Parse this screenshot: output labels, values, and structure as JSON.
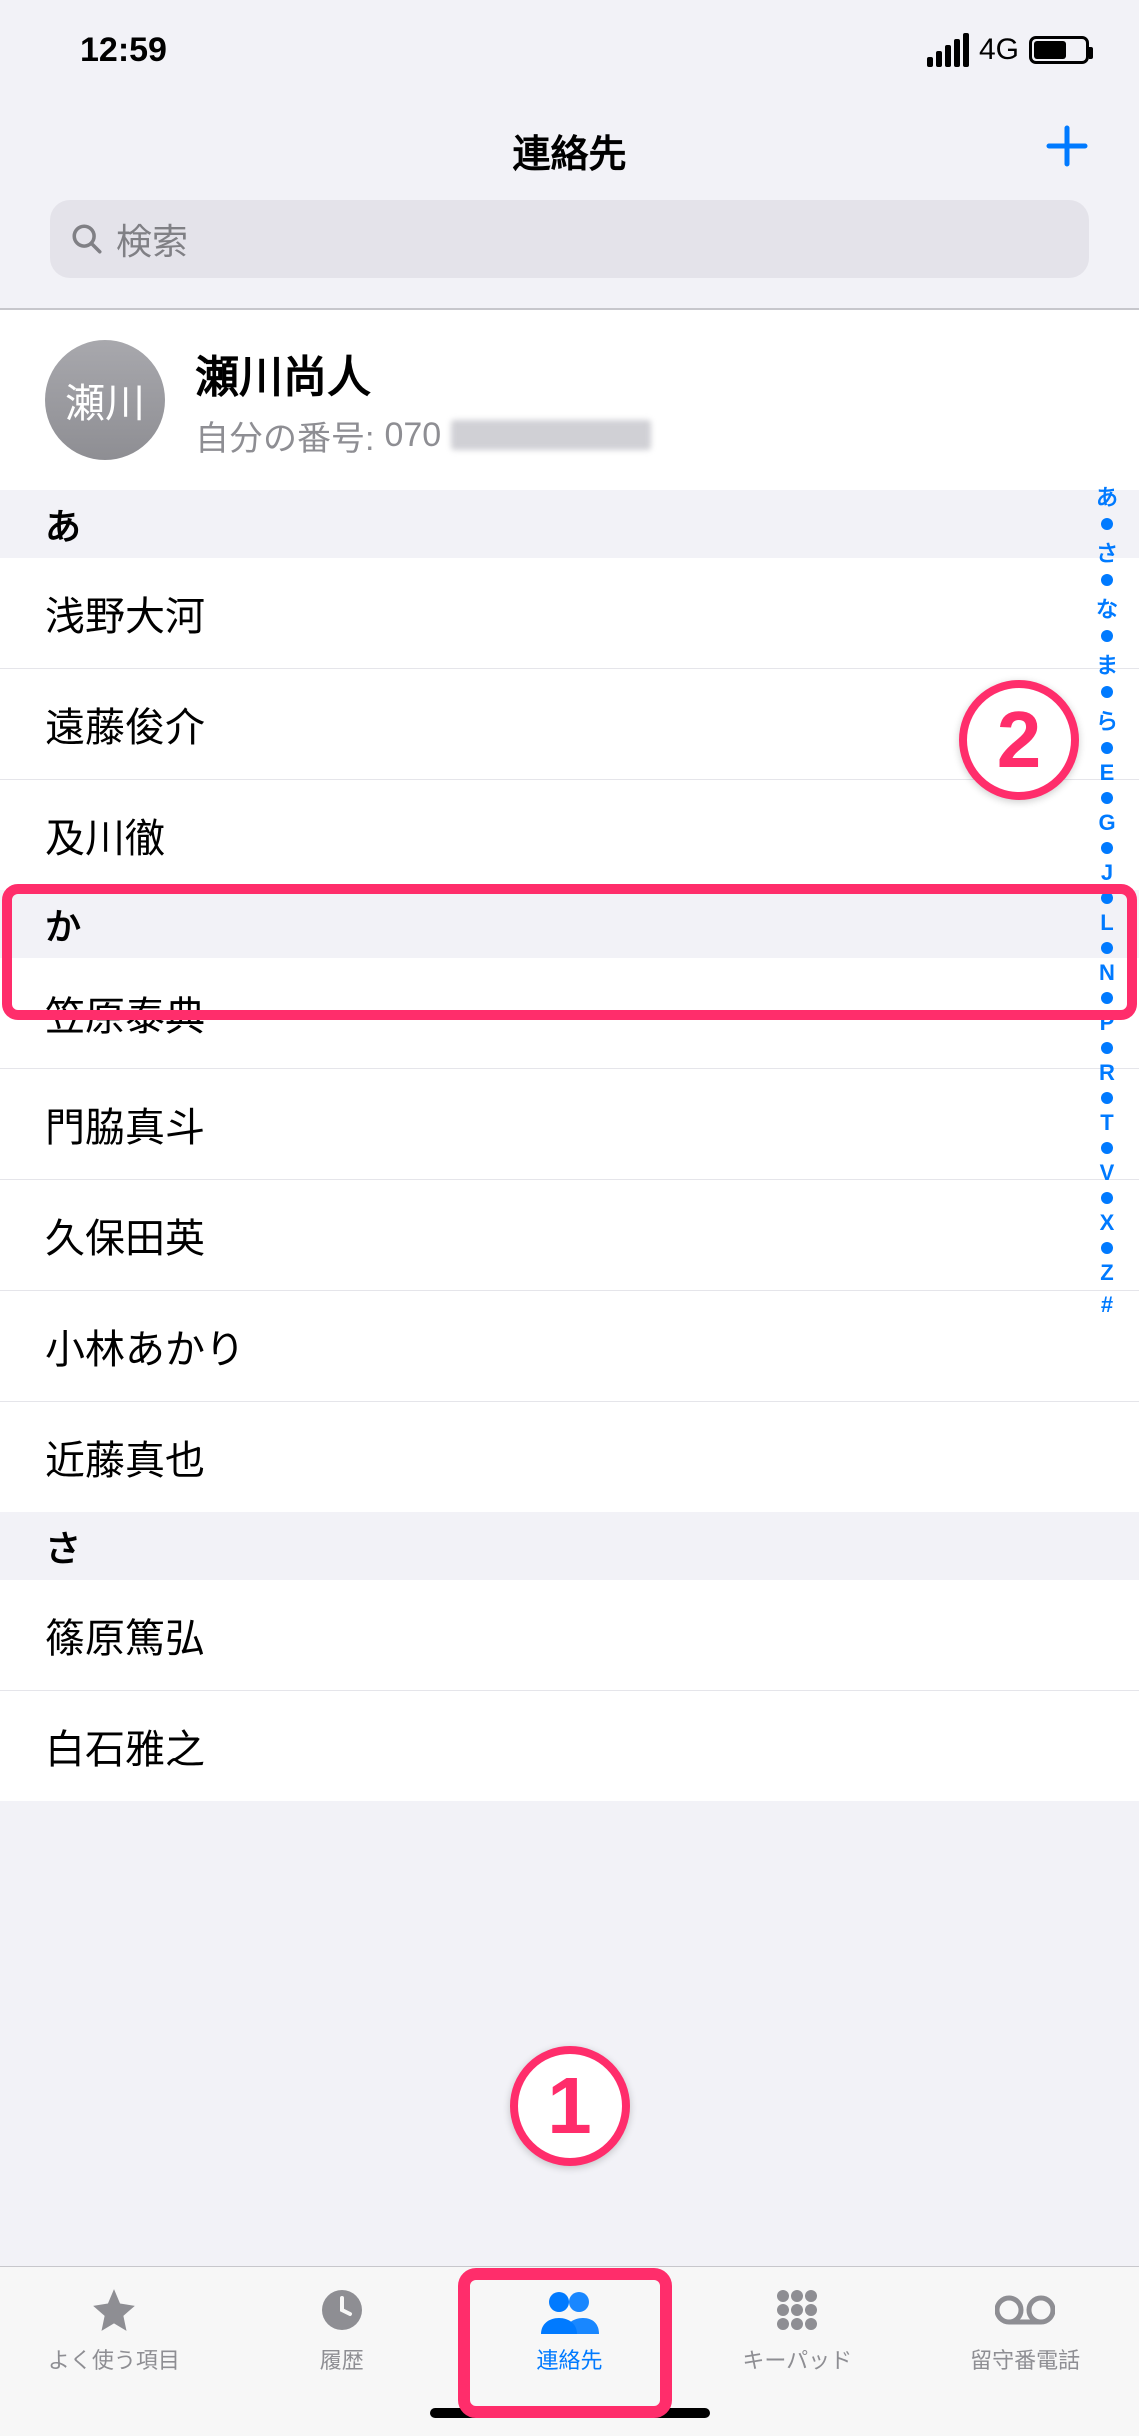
{
  "status": {
    "time": "12:59",
    "network": "4G"
  },
  "header": {
    "title": "連絡先"
  },
  "search": {
    "placeholder": "検索"
  },
  "me": {
    "avatar_text": "瀬川",
    "name": "瀬川尚人",
    "number_label": "自分の番号:",
    "number_prefix": "070"
  },
  "sections": [
    {
      "letter": "あ",
      "contacts": [
        "浅野大河",
        "遠藤俊介",
        "及川徹"
      ]
    },
    {
      "letter": "か",
      "contacts": [
        "笠原泰典",
        "門脇真斗",
        "久保田英",
        "小林あかり",
        "近藤真也"
      ]
    },
    {
      "letter": "さ",
      "contacts": [
        "篠原篤弘",
        "白石雅之"
      ]
    }
  ],
  "index": [
    "あ",
    "•",
    "さ",
    "•",
    "な",
    "•",
    "ま",
    "•",
    "ら",
    "•",
    "E",
    "•",
    "G",
    "•",
    "J",
    "•",
    "L",
    "•",
    "N",
    "•",
    "P",
    "•",
    "R",
    "•",
    "T",
    "•",
    "V",
    "•",
    "X",
    "•",
    "Z",
    "#"
  ],
  "tabs": {
    "favorites": "よく使う項目",
    "recents": "履歴",
    "contacts": "連絡先",
    "keypad": "キーパッド",
    "voicemail": "留守番電話"
  },
  "callouts": {
    "one": "1",
    "two": "2"
  }
}
